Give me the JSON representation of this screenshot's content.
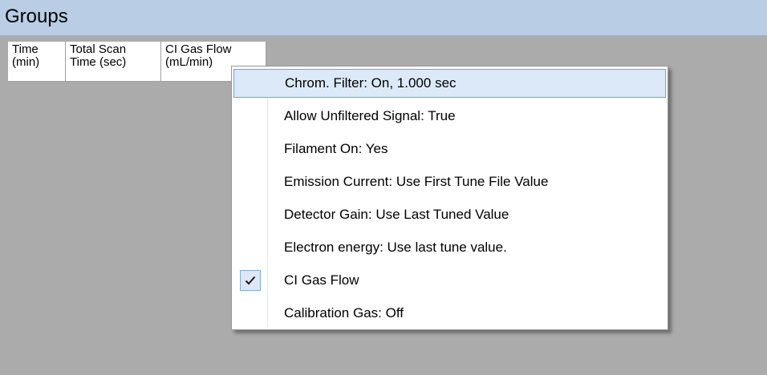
{
  "groups": {
    "title": "Groups"
  },
  "columns": [
    {
      "line1": "Time",
      "line2": "(min)"
    },
    {
      "line1": "Total Scan",
      "line2": "Time (sec)"
    },
    {
      "line1": "CI Gas Flow",
      "line2": "(mL/min)"
    }
  ],
  "context_menu": {
    "items": [
      {
        "label": "Chrom. Filter: On, 1.000 sec",
        "checked": false,
        "highlighted": true
      },
      {
        "label": "Allow Unfiltered Signal: True",
        "checked": false,
        "highlighted": false
      },
      {
        "label": "Filament On: Yes",
        "checked": false,
        "highlighted": false
      },
      {
        "label": "Emission Current: Use First Tune File Value",
        "checked": false,
        "highlighted": false
      },
      {
        "label": "Detector Gain: Use Last Tuned Value",
        "checked": false,
        "highlighted": false
      },
      {
        "label": "Electron energy: Use last tune value.",
        "checked": false,
        "highlighted": false
      },
      {
        "label": "CI Gas Flow",
        "checked": true,
        "highlighted": false
      },
      {
        "label": "Calibration Gas: Off",
        "checked": false,
        "highlighted": false
      }
    ],
    "check_icon": "checkmark-icon"
  },
  "colors": {
    "header_bg": "#b9cde5",
    "panel_bg": "#ababab",
    "highlight_bg": "#dbe9f8",
    "highlight_border": "#6ca4e0"
  }
}
